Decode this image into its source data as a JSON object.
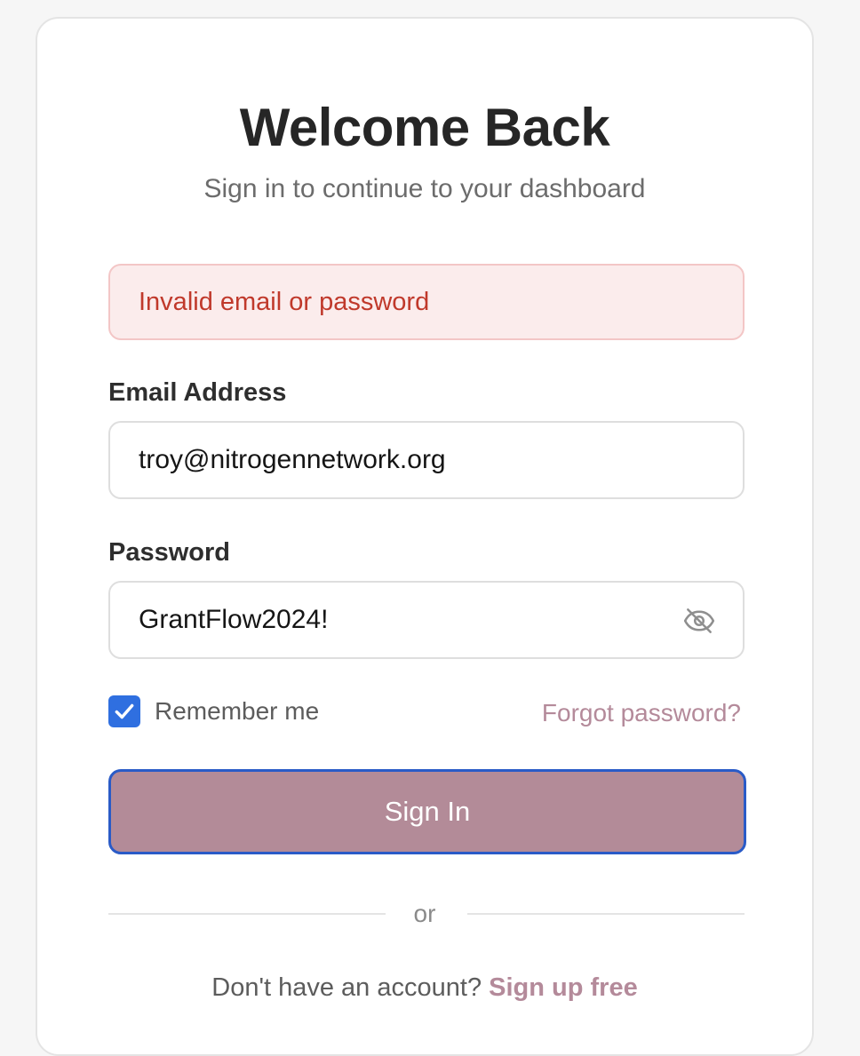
{
  "header": {
    "title": "Welcome Back",
    "subtitle": "Sign in to continue to your dashboard"
  },
  "alert": {
    "message": "Invalid email or password",
    "color": "#c0392b"
  },
  "form": {
    "email_label": "Email Address",
    "email_value": "troy@nitrogennetwork.org",
    "password_label": "Password",
    "password_value": "GrantFlow2024!",
    "password_toggle_icon": "eye-off-icon",
    "remember_label": "Remember me",
    "remember_checked": true,
    "forgot_label": "Forgot password?",
    "submit_label": "Sign In"
  },
  "divider": {
    "label": "or"
  },
  "footer": {
    "prompt": "Don't have an account?",
    "link_label": "Sign up free"
  },
  "colors": {
    "accent": "#b38b98",
    "focus_ring": "#2a5bc7",
    "checkbox": "#2f6fe0",
    "link": "#b48a9a",
    "error_bg": "#fbecec"
  }
}
